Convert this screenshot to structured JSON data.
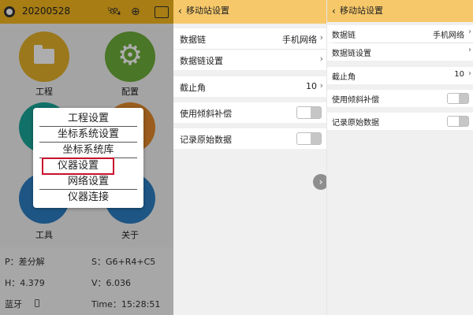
{
  "home": {
    "date": "20200528",
    "tiles": {
      "project": "工程",
      "config": "配置",
      "tools": "工具",
      "about": "关于"
    },
    "menu": {
      "items": [
        "工程设置",
        "坐标系统设置",
        "坐标系统库",
        "仪器设置",
        "网络设置",
        "仪器连接"
      ],
      "selected": "仪器设置"
    },
    "status": {
      "p": "P：差分解",
      "s": "S：G6+R4+C5",
      "h": "H：4.379",
      "v": "V：6.036",
      "bluetooth": "蓝牙",
      "time": "Time：15:28:51"
    }
  },
  "rover_settings": {
    "title": "移动站设置",
    "data_link_label": "数据链",
    "data_link_value": "手机网络",
    "data_link_setup_label": "数据链设置",
    "elevation_mask_label": "截止角",
    "elevation_mask_value": "10",
    "tilt_compensation_label": "使用倾斜补偿",
    "tilt_compensation_on": false,
    "record_raw_label": "记录原始数据",
    "record_raw_on": false
  },
  "colors": {
    "header_left": "#f6b81e",
    "header_settings": "#f6c86a",
    "highlight": "#c8102e",
    "project_tile": "#e5b12a",
    "config_tile": "#6dae3a",
    "blue_tile": "#2c7fc5"
  }
}
